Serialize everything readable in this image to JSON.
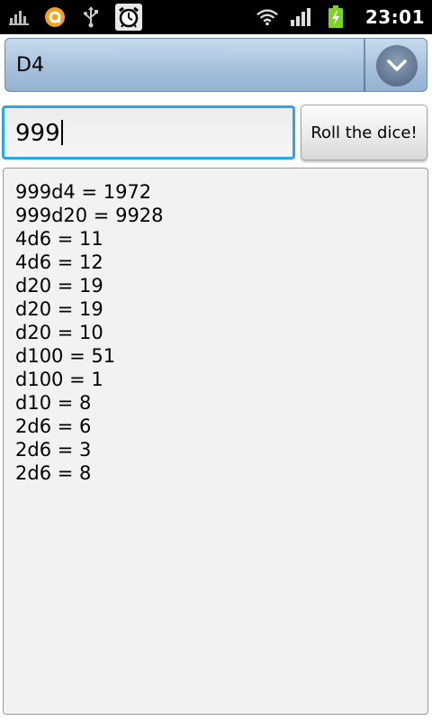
{
  "status_bar": {
    "time": "23:01",
    "icons": [
      "signal-bars-icon",
      "app-notification-icon",
      "usb-icon",
      "alarm-clock-icon",
      "wifi-icon",
      "cell-signal-icon",
      "battery-charging-icon"
    ],
    "colors": {
      "background": "#000000",
      "accent_orange": "#f7a21b",
      "battery_green": "#7ed321"
    }
  },
  "spinner": {
    "selected": "D4"
  },
  "input": {
    "value": "999"
  },
  "button": {
    "label": "Roll the dice!"
  },
  "results": [
    "999d4 = 1972",
    "999d20 = 9928",
    "4d6 = 11",
    "4d6 = 12",
    "d20 = 19",
    "d20 = 19",
    "d20 = 10",
    "d100 = 51",
    "d100 = 1",
    "d10 = 8",
    "2d6 = 6",
    "2d6 = 3",
    "2d6 = 8"
  ],
  "colors": {
    "focus_border": "#2aa7ea",
    "results_bg": "#f2f2f2"
  }
}
